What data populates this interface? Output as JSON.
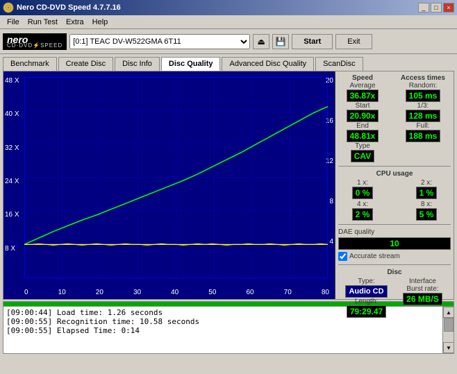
{
  "window": {
    "title": "Nero CD-DVD Speed 4.7.7.16"
  },
  "titleControls": [
    "_",
    "□",
    "×"
  ],
  "menu": {
    "items": [
      "File",
      "Run Test",
      "Extra",
      "Help"
    ]
  },
  "toolbar": {
    "drive": "[0:1]  TEAC DV-W522GMA 6T11",
    "startLabel": "Start",
    "exitLabel": "Exit"
  },
  "tabs": [
    {
      "label": "Benchmark",
      "active": false
    },
    {
      "label": "Create Disc",
      "active": false
    },
    {
      "label": "Disc Info",
      "active": false
    },
    {
      "label": "Disc Quality",
      "active": true
    },
    {
      "label": "Advanced Disc Quality",
      "active": false
    },
    {
      "label": "ScanDisc",
      "active": false
    }
  ],
  "chart": {
    "yLabels": [
      "48 X",
      "40 X",
      "32 X",
      "24 X",
      "16 X",
      "8 X",
      ""
    ],
    "y2Labels": [
      "20",
      "16",
      "12",
      "8",
      "4",
      ""
    ],
    "xLabels": [
      "0",
      "10",
      "20",
      "30",
      "40",
      "50",
      "60",
      "70",
      "80"
    ]
  },
  "speed": {
    "header": "Speed",
    "avgLabel": "Average",
    "avgValue": "36.87x",
    "startLabel": "Start",
    "startValue": "20.90x",
    "endLabel": "End",
    "endValue": "48.81x",
    "typeLabel": "Type",
    "typeValue": "CAV"
  },
  "accessTimes": {
    "header": "Access times",
    "randomLabel": "Random:",
    "randomValue": "105 ms",
    "oneThirdLabel": "1/3:",
    "oneThirdValue": "128 ms",
    "fullLabel": "Full:",
    "fullValue": "188 ms"
  },
  "cpuUsage": {
    "header": "CPU usage",
    "oneX": "1 x:",
    "oneXValue": "0 %",
    "twoX": "2 x:",
    "twoXValue": "1 %",
    "fourX": "4 x:",
    "fourXValue": "2 %",
    "eightX": "8 x:",
    "eightXValue": "5 %"
  },
  "daeQuality": {
    "label": "DAE quality",
    "value": "10"
  },
  "accurateStream": {
    "label": "Accurate stream",
    "checked": true
  },
  "disc": {
    "header": "Disc",
    "typeLabel": "Type:",
    "typeValue": "Audio CD",
    "lengthLabel": "Length:",
    "lengthValue": "79:29.47",
    "interfaceLabel": "Interface",
    "burstRateLabel": "Burst rate:",
    "burstRateValue": "26 MB/S"
  },
  "log": {
    "lines": [
      "[09:00:44]  Load time: 1.26 seconds",
      "[09:00:55]  Recognition time: 10.58 seconds",
      "[09:00:55]  Elapsed Time: 0:14"
    ]
  }
}
